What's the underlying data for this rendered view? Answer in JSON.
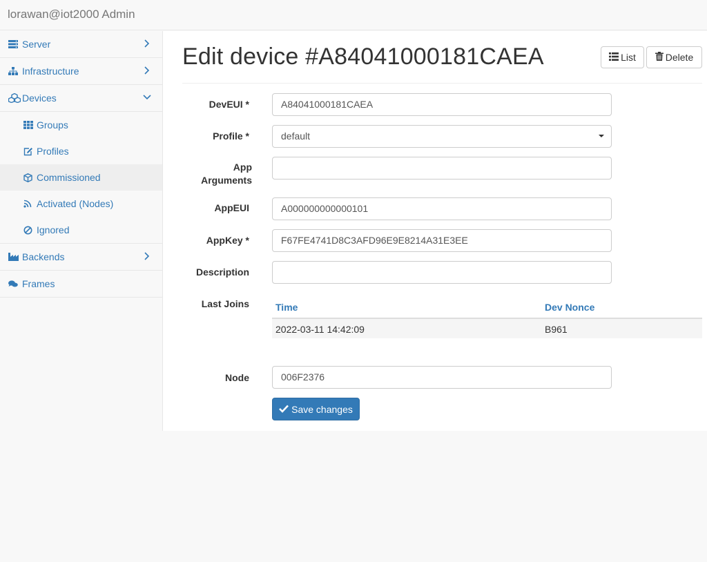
{
  "header": {
    "brand": "lorawan@iot2000 Admin"
  },
  "sidebar": {
    "items": [
      {
        "label": "Server",
        "icon": "server-icon"
      },
      {
        "label": "Infrastructure",
        "icon": "sitemap-icon"
      },
      {
        "label": "Devices",
        "icon": "cubes-icon"
      },
      {
        "label": "Backends",
        "icon": "industry-icon"
      },
      {
        "label": "Frames",
        "icon": "comments-icon"
      }
    ],
    "devices_sub": [
      {
        "label": "Groups",
        "icon": "grid-icon"
      },
      {
        "label": "Profiles",
        "icon": "edit-icon"
      },
      {
        "label": "Commissioned",
        "icon": "cube-icon"
      },
      {
        "label": "Activated (Nodes)",
        "icon": "rss-icon"
      },
      {
        "label": "Ignored",
        "icon": "ban-icon"
      }
    ]
  },
  "main": {
    "title": "Edit device #A84041000181CAEA",
    "list_button": "List",
    "delete_button": "Delete",
    "form": {
      "deveui_label": "DevEUI *",
      "deveui_value": "A84041000181CAEA",
      "profile_label": "Profile *",
      "profile_value": "default",
      "app_args_label_1": "App",
      "app_args_label_2": "Arguments",
      "app_args_value": "",
      "appeui_label": "AppEUI",
      "appeui_value": "A000000000000101",
      "appkey_label": "AppKey *",
      "appkey_value": "F67FE4741D8C3AFD96E9E8214A31E3EE",
      "description_label": "Description",
      "description_value": "",
      "last_joins_label": "Last Joins",
      "node_label": "Node",
      "node_value": "006F2376",
      "save_button": "Save changes"
    },
    "joins_table": {
      "columns": [
        "Time",
        "Dev Nonce"
      ],
      "rows": [
        [
          "2022-03-11 14:42:09",
          "B961"
        ]
      ]
    }
  },
  "colors": {
    "link": "#337ab7",
    "primary": "#337ab7",
    "text": "#333333",
    "muted": "#777777"
  }
}
